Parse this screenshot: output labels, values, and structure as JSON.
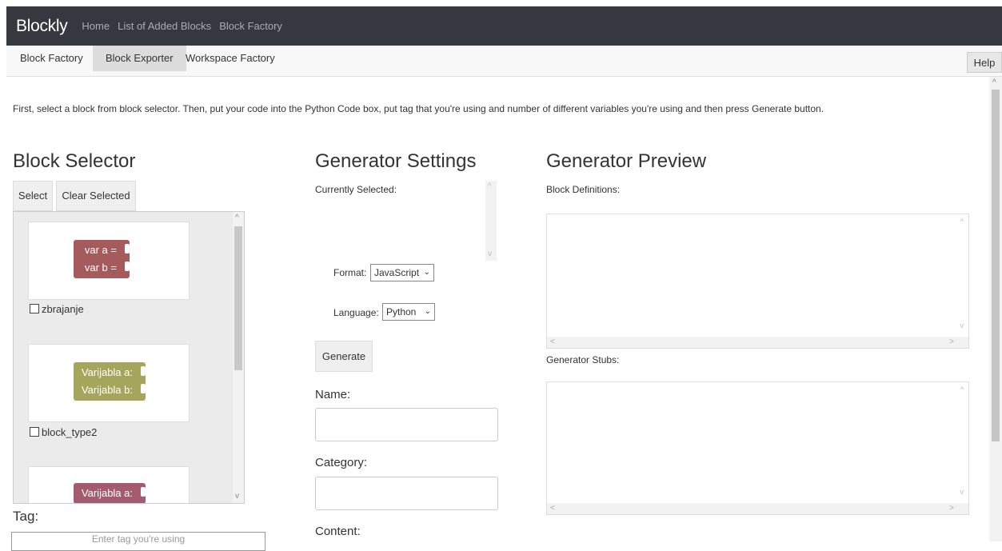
{
  "navbar": {
    "brand": "Blockly",
    "links": [
      "Home",
      "List of Added Blocks",
      "Block Factory"
    ]
  },
  "tabs": {
    "block_factory": "Block Factory",
    "block_exporter": "Block Exporter",
    "workspace_factory": "Workspace Factory",
    "help": "Help"
  },
  "instructions": "First, select a block from block selector. Then, put your code into the Python Code box, put tag that you're using and number of different variables you're using and then press Generate button.",
  "block_selector": {
    "title": "Block Selector",
    "select_label": "Select",
    "clear_label": "Clear Selected",
    "blocks": [
      {
        "name": "zbrajanje",
        "lines": [
          "var a =",
          "var b ="
        ],
        "color": "#a55b5b"
      },
      {
        "name": "block_type2",
        "lines": [
          "Varijabla a:",
          "Varijabla b:"
        ],
        "color": "#a5a55b"
      },
      {
        "name": "",
        "lines": [
          "Varijabla a:"
        ],
        "color": "#a55b6e"
      }
    ]
  },
  "tag": {
    "label": "Tag:",
    "placeholder": "Enter tag you're using"
  },
  "generator_settings": {
    "title": "Generator Settings",
    "currently_selected": "Currently Selected:",
    "format_label": "Format:",
    "format_value": "JavaScript",
    "language_label": "Language:",
    "language_value": "Python",
    "generate_label": "Generate",
    "name_label": "Name:",
    "category_label": "Category:",
    "content_label": "Content:"
  },
  "generator_preview": {
    "title": "Generator Preview",
    "block_definitions": "Block Definitions:",
    "generator_stubs": "Generator Stubs:"
  },
  "icons": {
    "up": "^",
    "down": "v",
    "left": "<",
    "right": ">",
    "chevron": "⌄"
  }
}
